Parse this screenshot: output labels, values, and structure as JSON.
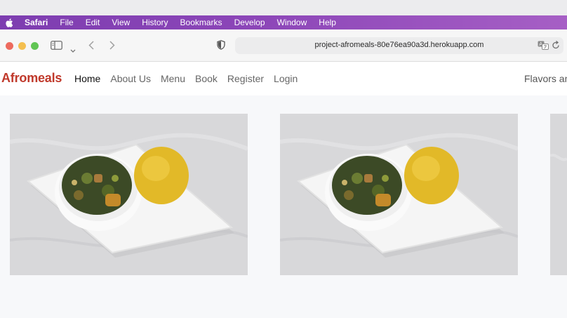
{
  "menubar": {
    "items": [
      "Safari",
      "File",
      "Edit",
      "View",
      "History",
      "Bookmarks",
      "Develop",
      "Window",
      "Help"
    ]
  },
  "toolbar": {
    "url": "project-afromeals-80e76ea90a3d.herokuapp.com"
  },
  "site": {
    "brand": "Afromeals",
    "nav": [
      "Home",
      "About Us",
      "Menu",
      "Book",
      "Register",
      "Login"
    ],
    "tagline": "Flavors an"
  },
  "colors": {
    "menubar_accent": "#8c46b8",
    "brand": "#c0392b"
  },
  "icons": [
    "apple-icon",
    "sidebar-icon",
    "back-icon",
    "forward-icon",
    "shield-icon",
    "translate-icon",
    "reload-icon"
  ]
}
